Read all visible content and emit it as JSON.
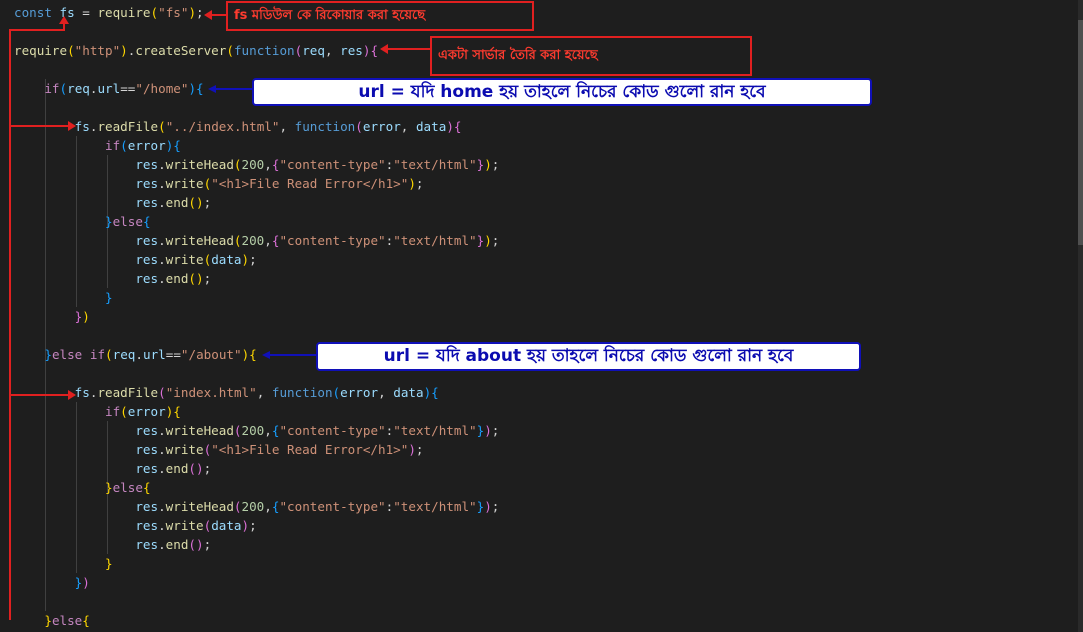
{
  "editor": {
    "theme_background": "#1e1e1e",
    "lines": [
      [
        [
          "kw",
          "const"
        ],
        [
          "pun",
          " "
        ],
        [
          "var",
          "fs"
        ],
        [
          "pun",
          " = "
        ],
        [
          "fn",
          "require"
        ],
        [
          "b1",
          "("
        ],
        [
          "str",
          "\"fs\""
        ],
        [
          "b1",
          ")"
        ],
        [
          "pun",
          ";"
        ]
      ],
      [],
      [
        [
          "fn",
          "require"
        ],
        [
          "b1",
          "("
        ],
        [
          "str",
          "\"http\""
        ],
        [
          "b1",
          ")"
        ],
        [
          "pun",
          "."
        ],
        [
          "fn",
          "createServer"
        ],
        [
          "b1",
          "("
        ],
        [
          "kw",
          "function"
        ],
        [
          "b2",
          "("
        ],
        [
          "var",
          "req"
        ],
        [
          "pun",
          ", "
        ],
        [
          "var",
          "res"
        ],
        [
          "b2",
          ")"
        ],
        [
          "b2",
          "{"
        ]
      ],
      [],
      [
        [
          "pun",
          "    "
        ],
        [
          "ctl",
          "if"
        ],
        [
          "b3",
          "("
        ],
        [
          "var",
          "req"
        ],
        [
          "pun",
          "."
        ],
        [
          "var",
          "url"
        ],
        [
          "pun",
          "=="
        ],
        [
          "str",
          "\"/home\""
        ],
        [
          "b3",
          ")"
        ],
        [
          "b3",
          "{"
        ]
      ],
      [],
      [
        [
          "pun",
          "        "
        ],
        [
          "var",
          "fs"
        ],
        [
          "pun",
          "."
        ],
        [
          "fn",
          "readFile"
        ],
        [
          "b1",
          "("
        ],
        [
          "str",
          "\"../index.html\""
        ],
        [
          "pun",
          ", "
        ],
        [
          "kw",
          "function"
        ],
        [
          "b2",
          "("
        ],
        [
          "var",
          "error"
        ],
        [
          "pun",
          ", "
        ],
        [
          "var",
          "data"
        ],
        [
          "b2",
          ")"
        ],
        [
          "b2",
          "{"
        ]
      ],
      [
        [
          "pun",
          "            "
        ],
        [
          "ctl",
          "if"
        ],
        [
          "b3",
          "("
        ],
        [
          "var",
          "error"
        ],
        [
          "b3",
          ")"
        ],
        [
          "b3",
          "{"
        ]
      ],
      [
        [
          "pun",
          "                "
        ],
        [
          "var",
          "res"
        ],
        [
          "pun",
          "."
        ],
        [
          "fn",
          "writeHead"
        ],
        [
          "b1",
          "("
        ],
        [
          "num",
          "200"
        ],
        [
          "pun",
          ","
        ],
        [
          "b2",
          "{"
        ],
        [
          "str",
          "\"content-type\""
        ],
        [
          "pun",
          ":"
        ],
        [
          "str",
          "\"text/html\""
        ],
        [
          "b2",
          "}"
        ],
        [
          "b1",
          ")"
        ],
        [
          "pun",
          ";"
        ]
      ],
      [
        [
          "pun",
          "                "
        ],
        [
          "var",
          "res"
        ],
        [
          "pun",
          "."
        ],
        [
          "fn",
          "write"
        ],
        [
          "b1",
          "("
        ],
        [
          "str",
          "\"<h1>File Read Error</h1>\""
        ],
        [
          "b1",
          ")"
        ],
        [
          "pun",
          ";"
        ]
      ],
      [
        [
          "pun",
          "                "
        ],
        [
          "var",
          "res"
        ],
        [
          "pun",
          "."
        ],
        [
          "fn",
          "end"
        ],
        [
          "b1",
          "()"
        ],
        [
          "pun",
          ";"
        ]
      ],
      [
        [
          "pun",
          "            "
        ],
        [
          "b3",
          "}"
        ],
        [
          "ctl",
          "else"
        ],
        [
          "b3",
          "{"
        ]
      ],
      [
        [
          "pun",
          "                "
        ],
        [
          "var",
          "res"
        ],
        [
          "pun",
          "."
        ],
        [
          "fn",
          "writeHead"
        ],
        [
          "b1",
          "("
        ],
        [
          "num",
          "200"
        ],
        [
          "pun",
          ","
        ],
        [
          "b2",
          "{"
        ],
        [
          "str",
          "\"content-type\""
        ],
        [
          "pun",
          ":"
        ],
        [
          "str",
          "\"text/html\""
        ],
        [
          "b2",
          "}"
        ],
        [
          "b1",
          ")"
        ],
        [
          "pun",
          ";"
        ]
      ],
      [
        [
          "pun",
          "                "
        ],
        [
          "var",
          "res"
        ],
        [
          "pun",
          "."
        ],
        [
          "fn",
          "write"
        ],
        [
          "b1",
          "("
        ],
        [
          "var",
          "data"
        ],
        [
          "b1",
          ")"
        ],
        [
          "pun",
          ";"
        ]
      ],
      [
        [
          "pun",
          "                "
        ],
        [
          "var",
          "res"
        ],
        [
          "pun",
          "."
        ],
        [
          "fn",
          "end"
        ],
        [
          "b1",
          "()"
        ],
        [
          "pun",
          ";"
        ]
      ],
      [
        [
          "pun",
          "            "
        ],
        [
          "b3",
          "}"
        ]
      ],
      [
        [
          "pun",
          "        "
        ],
        [
          "b2",
          "}"
        ],
        [
          "b1",
          ")"
        ]
      ],
      [],
      [
        [
          "pun",
          "    "
        ],
        [
          "b3",
          "}"
        ],
        [
          "ctl",
          "else"
        ],
        [
          "pun",
          " "
        ],
        [
          "ctl",
          "if"
        ],
        [
          "b1",
          "("
        ],
        [
          "var",
          "req"
        ],
        [
          "pun",
          "."
        ],
        [
          "var",
          "url"
        ],
        [
          "pun",
          "=="
        ],
        [
          "str",
          "\"/about\""
        ],
        [
          "b1",
          ")"
        ],
        [
          "b1",
          "{"
        ]
      ],
      [],
      [
        [
          "pun",
          "        "
        ],
        [
          "var",
          "fs"
        ],
        [
          "pun",
          "."
        ],
        [
          "fn",
          "readFile"
        ],
        [
          "b2",
          "("
        ],
        [
          "str",
          "\"index.html\""
        ],
        [
          "pun",
          ", "
        ],
        [
          "kw",
          "function"
        ],
        [
          "b3",
          "("
        ],
        [
          "var",
          "error"
        ],
        [
          "pun",
          ", "
        ],
        [
          "var",
          "data"
        ],
        [
          "b3",
          ")"
        ],
        [
          "b3",
          "{"
        ]
      ],
      [
        [
          "pun",
          "            "
        ],
        [
          "ctl",
          "if"
        ],
        [
          "b1",
          "("
        ],
        [
          "var",
          "error"
        ],
        [
          "b1",
          ")"
        ],
        [
          "b1",
          "{"
        ]
      ],
      [
        [
          "pun",
          "                "
        ],
        [
          "var",
          "res"
        ],
        [
          "pun",
          "."
        ],
        [
          "fn",
          "writeHead"
        ],
        [
          "b2",
          "("
        ],
        [
          "num",
          "200"
        ],
        [
          "pun",
          ","
        ],
        [
          "b3",
          "{"
        ],
        [
          "str",
          "\"content-type\""
        ],
        [
          "pun",
          ":"
        ],
        [
          "str",
          "\"text/html\""
        ],
        [
          "b3",
          "}"
        ],
        [
          "b2",
          ")"
        ],
        [
          "pun",
          ";"
        ]
      ],
      [
        [
          "pun",
          "                "
        ],
        [
          "var",
          "res"
        ],
        [
          "pun",
          "."
        ],
        [
          "fn",
          "write"
        ],
        [
          "b2",
          "("
        ],
        [
          "str",
          "\"<h1>File Read Error</h1>\""
        ],
        [
          "b2",
          ")"
        ],
        [
          "pun",
          ";"
        ]
      ],
      [
        [
          "pun",
          "                "
        ],
        [
          "var",
          "res"
        ],
        [
          "pun",
          "."
        ],
        [
          "fn",
          "end"
        ],
        [
          "b2",
          "()"
        ],
        [
          "pun",
          ";"
        ]
      ],
      [
        [
          "pun",
          "            "
        ],
        [
          "b1",
          "}"
        ],
        [
          "ctl",
          "else"
        ],
        [
          "b1",
          "{"
        ]
      ],
      [
        [
          "pun",
          "                "
        ],
        [
          "var",
          "res"
        ],
        [
          "pun",
          "."
        ],
        [
          "fn",
          "writeHead"
        ],
        [
          "b2",
          "("
        ],
        [
          "num",
          "200"
        ],
        [
          "pun",
          ","
        ],
        [
          "b3",
          "{"
        ],
        [
          "str",
          "\"content-type\""
        ],
        [
          "pun",
          ":"
        ],
        [
          "str",
          "\"text/html\""
        ],
        [
          "b3",
          "}"
        ],
        [
          "b2",
          ")"
        ],
        [
          "pun",
          ";"
        ]
      ],
      [
        [
          "pun",
          "                "
        ],
        [
          "var",
          "res"
        ],
        [
          "pun",
          "."
        ],
        [
          "fn",
          "write"
        ],
        [
          "b2",
          "("
        ],
        [
          "var",
          "data"
        ],
        [
          "b2",
          ")"
        ],
        [
          "pun",
          ";"
        ]
      ],
      [
        [
          "pun",
          "                "
        ],
        [
          "var",
          "res"
        ],
        [
          "pun",
          "."
        ],
        [
          "fn",
          "end"
        ],
        [
          "b2",
          "()"
        ],
        [
          "pun",
          ";"
        ]
      ],
      [
        [
          "pun",
          "            "
        ],
        [
          "b1",
          "}"
        ]
      ],
      [
        [
          "pun",
          "        "
        ],
        [
          "b3",
          "}"
        ],
        [
          "b2",
          ")"
        ]
      ],
      [],
      [
        [
          "pun",
          "    "
        ],
        [
          "b1",
          "}"
        ],
        [
          "ctl",
          "else"
        ],
        [
          "b1",
          "{"
        ]
      ]
    ]
  },
  "annotations": {
    "fs_module": "fs মডিউল কে রিকোয়ার করা হয়েছে",
    "create_server": "একটা সার্ভার তৈরি করা হয়েছে",
    "home_route": "url = যদি home হয় তাহলে নিচের কোড গুলো রান হবে",
    "about_route": "url = যদি about হয় তাহলে নিচের কোড গুলো রান হবে",
    "colors": {
      "red": "#e02020",
      "blue": "#1010b8"
    }
  }
}
